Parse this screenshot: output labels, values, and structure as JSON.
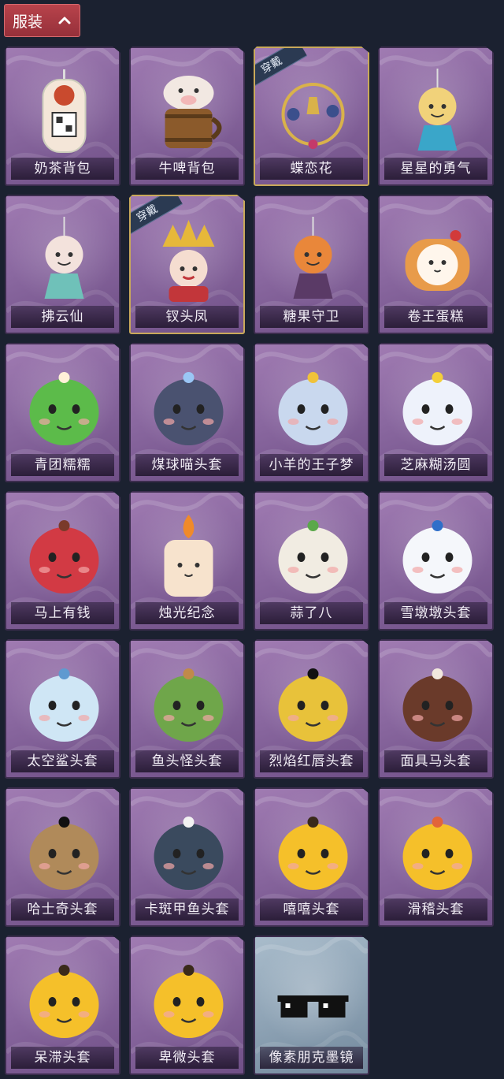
{
  "header": {
    "title": "服装"
  },
  "worn_label": "穿戴",
  "items": [
    {
      "name": "奶茶背包",
      "icon": "milk-tea-backpack-icon",
      "color": "#f4e6d8",
      "accent": "#c94a2e",
      "shape": "bottle",
      "worn": false,
      "special": false
    },
    {
      "name": "牛啤背包",
      "icon": "cow-beer-backpack-icon",
      "color": "#f2e8e2",
      "accent": "#8b5a2b",
      "shape": "barrel",
      "worn": false,
      "special": false
    },
    {
      "name": "蝶恋花",
      "icon": "butterfly-flower-icon",
      "color": "#d9b24a",
      "accent": "#3b4f8c",
      "shape": "ring",
      "worn": true,
      "special": false
    },
    {
      "name": "星星的勇气",
      "icon": "star-courage-icon",
      "color": "#f1d27a",
      "accent": "#3aa6c9",
      "shape": "charm",
      "worn": false,
      "special": false
    },
    {
      "name": "拂云仙",
      "icon": "cloud-fairy-icon",
      "color": "#f3e2dc",
      "accent": "#6fc1b9",
      "shape": "charm",
      "worn": false,
      "special": false
    },
    {
      "name": "钗头凤",
      "icon": "phoenix-hairpin-icon",
      "color": "#e6b83a",
      "accent": "#c2363a",
      "shape": "crown",
      "worn": true,
      "special": false
    },
    {
      "name": "糖果守卫",
      "icon": "candy-guard-icon",
      "color": "#e9873a",
      "accent": "#5a3a66",
      "shape": "charm",
      "worn": false,
      "special": false
    },
    {
      "name": "卷王蛋糕",
      "icon": "roll-cake-icon",
      "color": "#e89b4a",
      "accent": "#fff6ec",
      "shape": "cake",
      "worn": false,
      "special": false
    },
    {
      "name": "青团糯糯",
      "icon": "green-rice-ball-icon",
      "color": "#5cbb4a",
      "accent": "#fff1d8",
      "shape": "face",
      "worn": false,
      "special": false
    },
    {
      "name": "煤球喵头套",
      "icon": "black-cat-mask-icon",
      "color": "#4a5270",
      "accent": "#9ac6f5",
      "shape": "face",
      "worn": false,
      "special": false
    },
    {
      "name": "小羊的王子梦",
      "icon": "lamb-prince-mask-icon",
      "color": "#c9d8ee",
      "accent": "#f0c23a",
      "shape": "face",
      "worn": false,
      "special": false
    },
    {
      "name": "芝麻糊汤圆",
      "icon": "sesame-dumpling-mask-icon",
      "color": "#eef2fb",
      "accent": "#f3cf3a",
      "shape": "face",
      "worn": false,
      "special": false
    },
    {
      "name": "马上有钱",
      "icon": "red-horse-mask-icon",
      "color": "#d23a44",
      "accent": "#7a3a2a",
      "shape": "face",
      "worn": false,
      "special": false
    },
    {
      "name": "烛光纪念",
      "icon": "candle-mask-icon",
      "color": "#f7e3cd",
      "accent": "#f08a2a",
      "shape": "candle",
      "worn": false,
      "special": false
    },
    {
      "name": "蒜了八",
      "icon": "garlic-mask-icon",
      "color": "#f1ece2",
      "accent": "#5aa84a",
      "shape": "face",
      "worn": false,
      "special": false
    },
    {
      "name": "雪墩墩头套",
      "icon": "snowman-mask-icon",
      "color": "#f5f7fb",
      "accent": "#2f6fc9",
      "shape": "face",
      "worn": false,
      "special": false
    },
    {
      "name": "太空鲨头套",
      "icon": "space-shark-mask-icon",
      "color": "#cfe6f5",
      "accent": "#5f9ad0",
      "shape": "face",
      "worn": false,
      "special": false
    },
    {
      "name": "鱼头怪头套",
      "icon": "fish-head-mask-icon",
      "color": "#6fa64a",
      "accent": "#c08a4a",
      "shape": "face",
      "worn": false,
      "special": false
    },
    {
      "name": "烈焰红唇头套",
      "icon": "flame-lips-mask-icon",
      "color": "#e8c23a",
      "accent": "#111111",
      "shape": "face",
      "worn": false,
      "special": false
    },
    {
      "name": "面具马头套",
      "icon": "horse-mask-icon",
      "color": "#6a3a2a",
      "accent": "#f2e8de",
      "shape": "face",
      "worn": false,
      "special": false
    },
    {
      "name": "哈士奇头套",
      "icon": "husky-mask-icon",
      "color": "#b08a5a",
      "accent": "#111111",
      "shape": "face",
      "worn": false,
      "special": false
    },
    {
      "name": "卡斑甲鱼头套",
      "icon": "turtle-mask-icon",
      "color": "#3a4a5e",
      "accent": "#f2f2f2",
      "shape": "face",
      "worn": false,
      "special": false
    },
    {
      "name": "嘻嘻头套",
      "icon": "grin-emoji-mask-icon",
      "color": "#f5c02a",
      "accent": "#3a2a1a",
      "shape": "face",
      "worn": false,
      "special": false
    },
    {
      "name": "滑稽头套",
      "icon": "funny-emoji-mask-icon",
      "color": "#f5c02a",
      "accent": "#e2643a",
      "shape": "face",
      "worn": false,
      "special": false
    },
    {
      "name": "呆滞头套",
      "icon": "dazed-emoji-mask-icon",
      "color": "#f5c02a",
      "accent": "#3a2a1a",
      "shape": "face",
      "worn": false,
      "special": false
    },
    {
      "name": "卑微头套",
      "icon": "humble-emoji-mask-icon",
      "color": "#f5c02a",
      "accent": "#3a2a1a",
      "shape": "face",
      "worn": false,
      "special": false
    },
    {
      "name": "像素朋克墨镜",
      "icon": "pixel-sunglasses-icon",
      "color": "#111111",
      "accent": "#ffffff",
      "shape": "glasses",
      "worn": false,
      "special": true
    }
  ]
}
